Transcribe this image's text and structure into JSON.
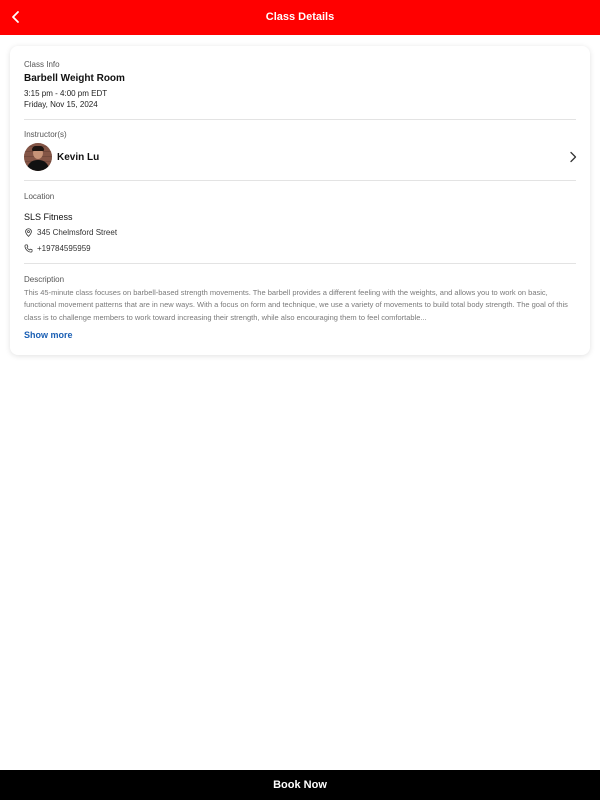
{
  "header": {
    "title": "Class Details",
    "back_icon": "chevron-left-icon"
  },
  "class_info": {
    "label": "Class Info",
    "name": "Barbell Weight Room",
    "time": "3:15 pm - 4:00 pm EDT",
    "date": "Friday, Nov 15, 2024"
  },
  "instructors": {
    "label": "Instructor(s)",
    "name": "Kevin Lu"
  },
  "location": {
    "label": "Location",
    "name": "SLS Fitness",
    "address": "345 Chelmsford Street",
    "phone": "+19784595959"
  },
  "description": {
    "label": "Description",
    "text": "This 45-minute class focuses on barbell-based strength movements. The barbell provides a different feeling with the weights, and allows you to work on basic, functional movement patterns that are in new ways. With a focus on form and technique, we use a variety of movements to build total body strength. The goal of this class is to challenge members to work toward increasing their strength, while also encouraging them to feel comfortable...",
    "show_more": "Show more"
  },
  "footer": {
    "book_label": "Book Now"
  },
  "colors": {
    "header_bg": "#ff0000",
    "footer_bg": "#000000",
    "link": "#1a5fb4"
  }
}
